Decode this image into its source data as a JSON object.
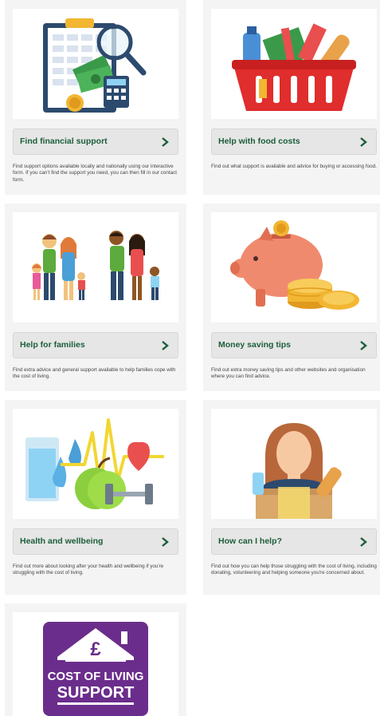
{
  "cards": [
    {
      "title": "Find financial support",
      "description": "Find support options available locally and nationally using our interactive form. If you can't find the support you need, you can then fill in our contact form."
    },
    {
      "title": "Help with food costs",
      "description": "Find out what support is available and advice for buying or accessing food."
    },
    {
      "title": "Help for families",
      "description": "Find extra advice and general support available to help families cope with the cost of living."
    },
    {
      "title": "Money saving tips",
      "description": "Find out extra money saving tips and other websites and organisation where you can find advice."
    },
    {
      "title": "Health and wellbeing",
      "description": "Find out more about looking after your health and wellbeing if you're struggling with the cost of living."
    },
    {
      "title": "How can I help?",
      "description": "Find out how you can help those struggling with the cost of living, including donating, volunteering and helping someone you're concerned about."
    }
  ],
  "logo": {
    "line1": "COST OF LIVING",
    "line2": "SUPPORT",
    "symbol": "£"
  },
  "icons": {
    "chevron": "chevron-right-icon"
  },
  "colors": {
    "button_text": "#1b5e3a",
    "card_bg": "#f4f4f4",
    "logo_purple": "#6b2d8c"
  }
}
